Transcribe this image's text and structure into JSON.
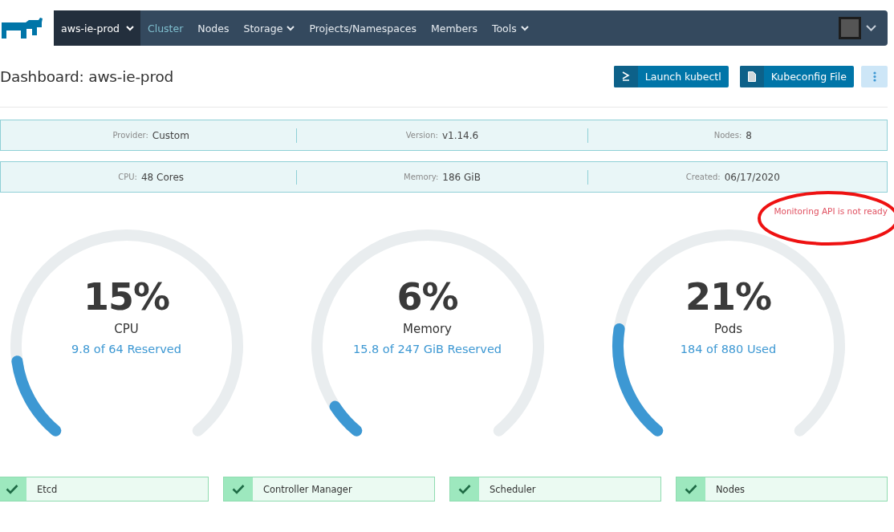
{
  "nav": {
    "cluster": "aws-ie-prod",
    "items": [
      {
        "label": "Cluster",
        "selected": true,
        "dropdown": false
      },
      {
        "label": "Nodes",
        "selected": false,
        "dropdown": false
      },
      {
        "label": "Storage",
        "selected": false,
        "dropdown": true
      },
      {
        "label": "Projects/Namespaces",
        "selected": false,
        "dropdown": false
      },
      {
        "label": "Members",
        "selected": false,
        "dropdown": false
      },
      {
        "label": "Tools",
        "selected": false,
        "dropdown": true
      }
    ]
  },
  "header": {
    "title": "Dashboard: aws-ie-prod",
    "buttons": [
      {
        "kind": "terminal",
        "label": "Launch kubectl"
      },
      {
        "kind": "file",
        "label": "Kubeconfig File"
      },
      {
        "kind": "more"
      }
    ]
  },
  "info_rows": [
    [
      {
        "label": "Provider:",
        "value": "Custom"
      },
      {
        "label": "Version:",
        "value": "v1.14.6"
      },
      {
        "label": "Nodes:",
        "value": "8"
      }
    ],
    [
      {
        "label": "CPU:",
        "value": "48 Cores"
      },
      {
        "label": "Memory:",
        "value": "186 GiB"
      },
      {
        "label": "Created:",
        "value": "06/17/2020"
      }
    ]
  ],
  "monitoring_notice": "Monitoring API is not ready",
  "gauges": [
    {
      "percent": "15%",
      "name": "CPU",
      "detail": "9.8 of 64 Reserved",
      "level": 0.15
    },
    {
      "percent": "6%",
      "name": "Memory",
      "detail": "15.8 of 247 GiB Reserved",
      "level": 0.06
    },
    {
      "percent": "21%",
      "name": "Pods",
      "detail": "184 of 880 Used",
      "level": 0.21
    }
  ],
  "health": [
    {
      "label": "Etcd",
      "healthy": true
    },
    {
      "label": "Controller Manager",
      "healthy": true
    },
    {
      "label": "Scheduler",
      "healthy": true
    },
    {
      "label": "Nodes",
      "healthy": true
    }
  ]
}
